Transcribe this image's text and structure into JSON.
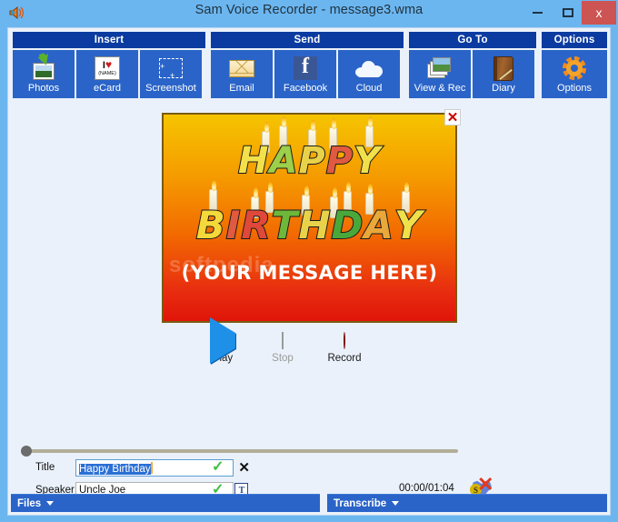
{
  "window": {
    "title": "Sam Voice Recorder - message3.wma",
    "app_icon": "speaker-icon",
    "minimize_label": "Minimize",
    "maximize_label": "Maximize",
    "close_label": "x"
  },
  "ribbon": {
    "groups": [
      {
        "title": "Insert",
        "buttons": [
          {
            "label": "Photos",
            "icon": "photos-icon"
          },
          {
            "label": "eCard",
            "icon": "ecard-icon",
            "icon_text_top": "I",
            "icon_text_heart": "♥",
            "icon_text_bottom": "(NAME)"
          },
          {
            "label": "Screenshot",
            "icon": "screenshot-icon"
          }
        ]
      },
      {
        "title": "Send",
        "buttons": [
          {
            "label": "Email",
            "icon": "envelope-icon"
          },
          {
            "label": "Facebook",
            "icon": "facebook-icon",
            "glyph": "f"
          },
          {
            "label": "Cloud",
            "icon": "cloud-icon"
          }
        ]
      },
      {
        "title": "Go To",
        "buttons": [
          {
            "label": "View & Rec",
            "icon": "photo-stack-icon"
          },
          {
            "label": "Diary",
            "icon": "diary-book-icon"
          }
        ]
      },
      {
        "title": "Options",
        "buttons": [
          {
            "label": "Options",
            "icon": "gear-icon"
          }
        ]
      }
    ]
  },
  "card": {
    "close_glyph": "✕",
    "watermark": "softpedia",
    "line1": "HAPPY",
    "line2": "BIRTHDAY",
    "message": "(YOUR MESSAGE HERE)",
    "line1_letters": [
      {
        "ch": "H",
        "color": "#f2e14a"
      },
      {
        "ch": "A",
        "color": "#9ccf4a"
      },
      {
        "ch": "P",
        "color": "#e8d24a"
      },
      {
        "ch": "P",
        "color": "#e05a42"
      },
      {
        "ch": "Y",
        "color": "#f0e04a"
      }
    ],
    "line2_letters": [
      {
        "ch": "B",
        "color": "#f5d93a"
      },
      {
        "ch": "I",
        "color": "#e05a42"
      },
      {
        "ch": "R",
        "color": "#e0483a"
      },
      {
        "ch": "T",
        "color": "#6db83a"
      },
      {
        "ch": "H",
        "color": "#e8d24a"
      },
      {
        "ch": "D",
        "color": "#4aa83a"
      },
      {
        "ch": "A",
        "color": "#e8a83a"
      },
      {
        "ch": "Y",
        "color": "#f0e04a"
      }
    ],
    "gradient_top": "#f5c400",
    "gradient_bottom": "#e01508"
  },
  "transport": {
    "play_label": "Play",
    "stop_label": "Stop",
    "record_label": "Record",
    "stop_enabled": false
  },
  "playback": {
    "slider_position_percent": 0,
    "timecode": "00:00/01:04"
  },
  "form": {
    "title_label": "Title",
    "title_value": "Happy Birthday",
    "title_selected": true,
    "title_valid_glyph": "✓",
    "title_clear_glyph": "✕",
    "speaker_label": "Speaker",
    "speaker_value": "Uncle Joe",
    "speaker_valid_glyph": "✓",
    "speaker_button_glyph": "T",
    "speaker_button_icon": "text-format-icon"
  },
  "delete_icon": {
    "name": "delete-sound-icon",
    "badge": "S",
    "x_glyph": "✕"
  },
  "statusbar": {
    "files_label": "Files",
    "transcribe_label": "Transcribe"
  },
  "colors": {
    "titlebar": "#6cb6f0",
    "close_button": "#cc5452",
    "ribbon_header": "#0b3ba0",
    "ribbon_button": "#2a64c8",
    "client_bg": "#eaf1fa",
    "statusbar": "#2a64c8"
  }
}
